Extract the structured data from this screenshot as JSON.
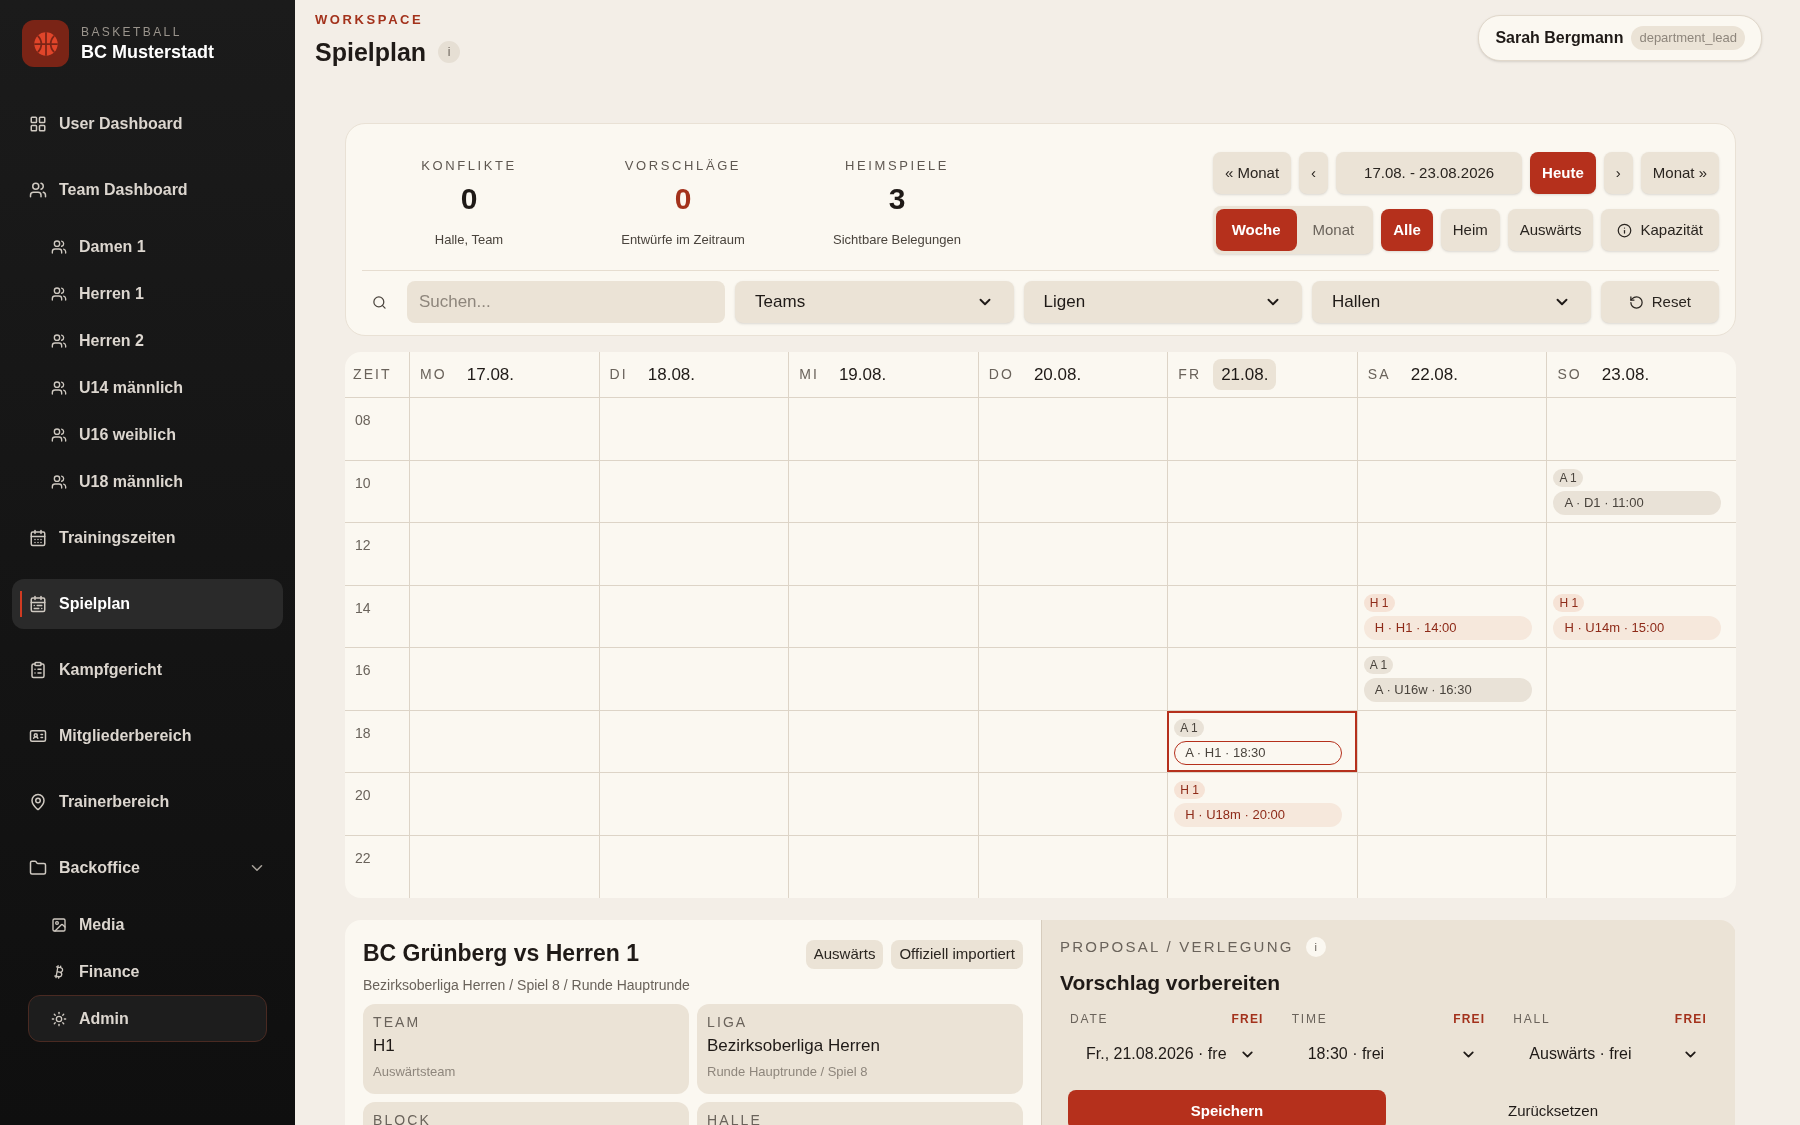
{
  "brand": {
    "eyebrow": "BASKETBALL",
    "name": "BC Musterstadt"
  },
  "sidebar": {
    "items": [
      {
        "label": "User Dashboard",
        "selected": false
      },
      {
        "label": "Team Dashboard",
        "selected": false,
        "children": [
          {
            "label": "Damen 1",
            "selected": false
          },
          {
            "label": "Herren 1",
            "selected": false
          },
          {
            "label": "Herren 2",
            "selected": false
          },
          {
            "label": "U14 männlich",
            "selected": false
          },
          {
            "label": "U16 weiblich",
            "selected": false
          },
          {
            "label": "U18 männlich",
            "selected": false
          }
        ]
      },
      {
        "label": "Trainingszeiten",
        "selected": false
      },
      {
        "label": "Spielplan",
        "selected": true
      },
      {
        "label": "Kampfgericht",
        "selected": false
      },
      {
        "label": "Mitgliederbereich",
        "selected": false
      },
      {
        "label": "Trainerbereich",
        "selected": false
      },
      {
        "label": "Backoffice",
        "selected": false,
        "expanded": true,
        "children": [
          {
            "label": "Media",
            "selected": false,
            "focused": false
          },
          {
            "label": "Finance",
            "selected": false,
            "focused": false
          },
          {
            "label": "Admin",
            "selected": false,
            "focused": true
          }
        ]
      }
    ]
  },
  "header": {
    "eyebrow": "WORKSPACE",
    "title": "Spielplan",
    "info": "i",
    "user": {
      "name": "Sarah Bergmann",
      "role": "department_lead"
    }
  },
  "stats": [
    {
      "label": "KONFLIKTE",
      "value": "0",
      "note": "Halle, Team",
      "color": "#1f1a17"
    },
    {
      "label": "VORSCHLÄGE",
      "value": "0",
      "note": "Entwürfe im Zeitraum",
      "color": "#a3321c"
    },
    {
      "label": "HEIMSPIELE",
      "value": "3",
      "note": "Sichtbare Belegungen",
      "color": "#1f1a17"
    }
  ],
  "navigation": [
    {
      "label": "« Monat",
      "kind": "button"
    },
    {
      "label": "‹",
      "kind": "button"
    },
    {
      "label": "17.08. - 23.08.2026",
      "kind": "range"
    },
    {
      "label": "Heute",
      "kind": "primary"
    },
    {
      "label": "›",
      "kind": "button"
    },
    {
      "label": "Monat »",
      "kind": "button"
    }
  ],
  "view_toggle": [
    {
      "label": "Woche",
      "selected": true
    },
    {
      "label": "Monat",
      "selected": false
    }
  ],
  "location_filter": [
    {
      "label": "Alle",
      "selected": true
    },
    {
      "label": "Heim",
      "selected": false
    },
    {
      "label": "Auswärts",
      "selected": false
    }
  ],
  "capacity_button": {
    "label": "Kapazität"
  },
  "filters": {
    "search": {
      "placeholder": "Suchen..."
    },
    "selects": [
      {
        "value": "Teams"
      },
      {
        "value": "Ligen"
      },
      {
        "value": "Hallen"
      }
    ],
    "reset": {
      "label": "Reset"
    }
  },
  "calendar": {
    "time_heading": "ZEIT",
    "days": [
      {
        "weekday": "MO",
        "date": "17.08.",
        "today": false
      },
      {
        "weekday": "DI",
        "date": "18.08.",
        "today": false
      },
      {
        "weekday": "MI",
        "date": "19.08.",
        "today": false
      },
      {
        "weekday": "DO",
        "date": "20.08.",
        "today": false
      },
      {
        "weekday": "FR",
        "date": "21.08.",
        "today": true
      },
      {
        "weekday": "SA",
        "date": "22.08.",
        "today": false
      },
      {
        "weekday": "SO",
        "date": "23.08.",
        "today": false
      }
    ],
    "rows": [
      {
        "time": "08",
        "cells": [
          {},
          {},
          {},
          {},
          {},
          {},
          {}
        ]
      },
      {
        "time": "10",
        "cells": [
          {},
          {},
          {},
          {},
          {},
          {},
          {
            "events": [
              {
                "tag": "A 1",
                "label": "A · D1 · 11:00",
                "kind": "away",
                "selected": false
              }
            ]
          }
        ]
      },
      {
        "time": "12",
        "cells": [
          {},
          {},
          {},
          {},
          {},
          {},
          {}
        ]
      },
      {
        "time": "14",
        "cells": [
          {},
          {},
          {},
          {},
          {},
          {
            "events": [
              {
                "tag": "H 1",
                "label": "H · H1 · 14:00",
                "kind": "home",
                "selected": false
              }
            ]
          },
          {
            "events": [
              {
                "tag": "H 1",
                "label": "H · U14m · 15:00",
                "kind": "home",
                "selected": false
              }
            ]
          }
        ]
      },
      {
        "time": "16",
        "cells": [
          {},
          {},
          {},
          {},
          {},
          {
            "events": [
              {
                "tag": "A 1",
                "label": "A · U16w · 16:30",
                "kind": "away",
                "selected": false
              }
            ]
          },
          {}
        ]
      },
      {
        "time": "18",
        "cells": [
          {},
          {},
          {},
          {},
          {
            "events": [
              {
                "tag": "A 1",
                "label": "A · H1 · 18:30",
                "kind": "away",
                "selected": true
              }
            ]
          },
          {},
          {}
        ]
      },
      {
        "time": "20",
        "cells": [
          {},
          {},
          {},
          {},
          {
            "events": [
              {
                "tag": "H 1",
                "label": "H · U18m · 20:00",
                "kind": "home",
                "selected": false
              }
            ]
          },
          {},
          {}
        ]
      },
      {
        "time": "22",
        "cells": [
          {},
          {},
          {},
          {},
          {},
          {},
          {}
        ]
      }
    ]
  },
  "game": {
    "title": "BC Grünberg vs Herren 1",
    "badges": [
      "Auswärts",
      "Offiziell importiert"
    ],
    "subtitle": "Bezirksoberliga Herren / Spiel 8 / Runde Hauptrunde",
    "fields": [
      {
        "label": "TEAM",
        "value": "H1",
        "note": "Auswärtsteam"
      },
      {
        "label": "LIGA",
        "value": "Bezirksoberliga Herren",
        "note": "Runde Hauptrunde / Spiel 8"
      },
      {
        "label": "BLOCK"
      },
      {
        "label": "HALLE"
      }
    ]
  },
  "proposal": {
    "eyebrow": "PROPOSAL / VERLEGUNG",
    "info": "i",
    "title": "Vorschlag vorbereiten",
    "fields": [
      {
        "label": "DATE",
        "status": "FREI",
        "value": "Fr., 21.08.2026 · fre"
      },
      {
        "label": "TIME",
        "status": "FREI",
        "value": "18:30 · frei"
      },
      {
        "label": "HALL",
        "status": "FREI",
        "value": "Auswärts · frei"
      }
    ],
    "save": "Speichern",
    "reset": "Zurücksetzen"
  }
}
